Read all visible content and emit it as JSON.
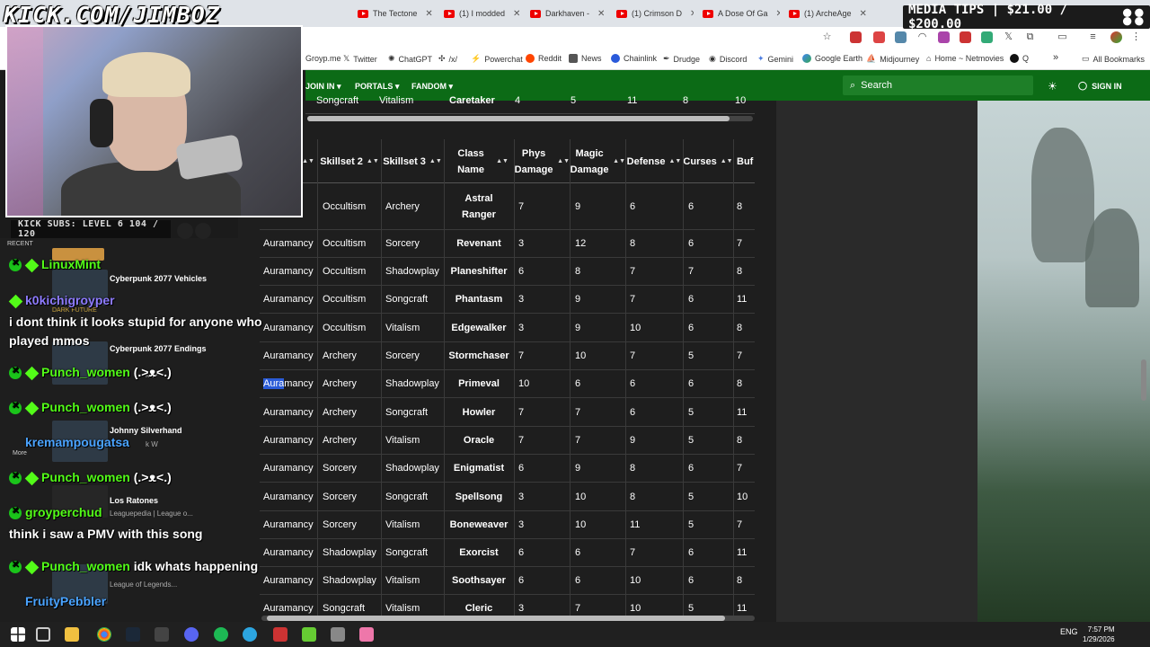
{
  "browser": {
    "tabs": [
      {
        "label": "The Tectone"
      },
      {
        "label": "(1) I modded"
      },
      {
        "label": "Darkhaven -"
      },
      {
        "label": "(1) Crimson D"
      },
      {
        "label": "A Dose Of Ga"
      },
      {
        "label": "(1) ArcheAge"
      }
    ],
    "bookmarks": [
      {
        "label": "Groyp.me"
      },
      {
        "label": "Twitter"
      },
      {
        "label": "ChatGPT"
      },
      {
        "label": "/x/"
      },
      {
        "label": "Powerchat"
      },
      {
        "label": "Reddit"
      },
      {
        "label": "News"
      },
      {
        "label": "Chainlink"
      },
      {
        "label": "Drudge"
      },
      {
        "label": "Discord"
      },
      {
        "label": "Gemini"
      },
      {
        "label": "Google Earth"
      },
      {
        "label": "Midjourney"
      },
      {
        "label": "Home ~ Netmovies"
      },
      {
        "label": "Q"
      }
    ],
    "all_bookmarks": "All Bookmarks",
    "more": "»"
  },
  "wiki": {
    "nav": {
      "join": "JOIN IN ▾",
      "portals": "PORTALS ▾",
      "fandom": "FANDOM ▾"
    },
    "search_placeholder": "Search",
    "sign_in": "SIGN IN"
  },
  "top_fragment": {
    "skill": "Songcraft",
    "skill2": "Vitalism",
    "class": "Caretaker",
    "vals": [
      "4",
      "5",
      "11",
      "8",
      "10"
    ]
  },
  "table": {
    "headers": {
      "skillset2": "Skillset 2",
      "skillset3": "Skillset 3",
      "class": "Class Name",
      "phys": "Phys Damage",
      "magic": "Magic Damage",
      "defense": "Defense",
      "curses": "Curses",
      "buffs": "Buf"
    },
    "rows": [
      {
        "s1": "",
        "s2": "Occultism",
        "s3": "Archery",
        "cls": "Astral Ranger",
        "phys": "7",
        "magic": "9",
        "def": "6",
        "curses": "6",
        "buffs": "8"
      },
      {
        "s1": "Auramancy",
        "s2": "Occultism",
        "s3": "Sorcery",
        "cls": "Revenant",
        "phys": "3",
        "magic": "12",
        "def": "8",
        "curses": "6",
        "buffs": "7"
      },
      {
        "s1": "Auramancy",
        "s2": "Occultism",
        "s3": "Shadowplay",
        "cls": "Planeshifter",
        "phys": "6",
        "magic": "8",
        "def": "7",
        "curses": "7",
        "buffs": "8"
      },
      {
        "s1": "Auramancy",
        "s2": "Occultism",
        "s3": "Songcraft",
        "cls": "Phantasm",
        "phys": "3",
        "magic": "9",
        "def": "7",
        "curses": "6",
        "buffs": "11"
      },
      {
        "s1": "Auramancy",
        "s2": "Occultism",
        "s3": "Vitalism",
        "cls": "Edgewalker",
        "phys": "3",
        "magic": "9",
        "def": "10",
        "curses": "6",
        "buffs": "8"
      },
      {
        "s1": "Auramancy",
        "s2": "Archery",
        "s3": "Sorcery",
        "cls": "Stormchaser",
        "phys": "7",
        "magic": "10",
        "def": "7",
        "curses": "5",
        "buffs": "7"
      },
      {
        "s1": "Auramancy",
        "s2": "Archery",
        "s3": "Shadowplay",
        "cls": "Primeval",
        "phys": "10",
        "magic": "6",
        "def": "6",
        "curses": "6",
        "buffs": "8"
      },
      {
        "s1": "Auramancy",
        "s2": "Archery",
        "s3": "Songcraft",
        "cls": "Howler",
        "phys": "7",
        "magic": "7",
        "def": "6",
        "curses": "5",
        "buffs": "11"
      },
      {
        "s1": "Auramancy",
        "s2": "Archery",
        "s3": "Vitalism",
        "cls": "Oracle",
        "phys": "7",
        "magic": "7",
        "def": "9",
        "curses": "5",
        "buffs": "8"
      },
      {
        "s1": "Auramancy",
        "s2": "Sorcery",
        "s3": "Shadowplay",
        "cls": "Enigmatist",
        "phys": "6",
        "magic": "9",
        "def": "8",
        "curses": "6",
        "buffs": "7"
      },
      {
        "s1": "Auramancy",
        "s2": "Sorcery",
        "s3": "Songcraft",
        "cls": "Spellsong",
        "phys": "3",
        "magic": "10",
        "def": "8",
        "curses": "5",
        "buffs": "10"
      },
      {
        "s1": "Auramancy",
        "s2": "Sorcery",
        "s3": "Vitalism",
        "cls": "Boneweaver",
        "phys": "3",
        "magic": "10",
        "def": "11",
        "curses": "5",
        "buffs": "7"
      },
      {
        "s1": "Auramancy",
        "s2": "Shadowplay",
        "s3": "Songcraft",
        "cls": "Exorcist",
        "phys": "6",
        "magic": "6",
        "def": "7",
        "curses": "6",
        "buffs": "11"
      },
      {
        "s1": "Auramancy",
        "s2": "Shadowplay",
        "s3": "Vitalism",
        "cls": "Soothsayer",
        "phys": "6",
        "magic": "6",
        "def": "10",
        "curses": "6",
        "buffs": "8"
      },
      {
        "s1": "Auramancy",
        "s2": "Songcraft",
        "s3": "Vitalism",
        "cls": "Cleric",
        "phys": "3",
        "magic": "7",
        "def": "10",
        "curses": "5",
        "buffs": "11"
      }
    ]
  },
  "stream": {
    "watermark": "KICK.COM/JIMBOZ",
    "media_tips": "MEDIA TIPS | $21.00 / $200.00",
    "subs": "KICK SUBS: LEVEL 6 104 / 120",
    "recent": "RECENT"
  },
  "chat": [
    {
      "user": "LinuxMint",
      "msg": ""
    },
    {
      "user": "k0kichigroyper",
      "msg": ""
    },
    {
      "user": "",
      "msg": "i dont think it looks stupid for anyone who"
    },
    {
      "user": "",
      "msg": "played mmos"
    },
    {
      "user": "Punch_women",
      "msg": "(.>ᴥ<.)"
    },
    {
      "user": "Punch_women",
      "msg": "(.>ᴥ<.)"
    },
    {
      "user": "kremampougatsa",
      "msg": ""
    },
    {
      "user": "Punch_women",
      "msg": "(.>ᴥ<.)"
    },
    {
      "user": "groyperchud",
      "msg": ""
    },
    {
      "user": "",
      "msg": "think i saw a PMV with this song"
    },
    {
      "user": "Punch_women",
      "msg": "idk whats happening"
    },
    {
      "user": "FruityPebbler",
      "msg": ""
    }
  ],
  "side_thumbs": [
    {
      "title": "Cyberpunk 2077 Vehicles",
      "sub": "DARK FUTURE"
    },
    {
      "title": "Cyberpunk 2077 Endings",
      "sub": "k W"
    },
    {
      "title": "Johnny Silverhand",
      "sub": "k W"
    },
    {
      "title": "Los Ratones",
      "sub": "Leaguepedia | League o..."
    },
    {
      "title": "",
      "sub": "League of Legends..."
    }
  ],
  "taskbar": {
    "lang": "ENG",
    "time": "7:57 PM",
    "date": "1/29/2026",
    "more_label": "More"
  }
}
